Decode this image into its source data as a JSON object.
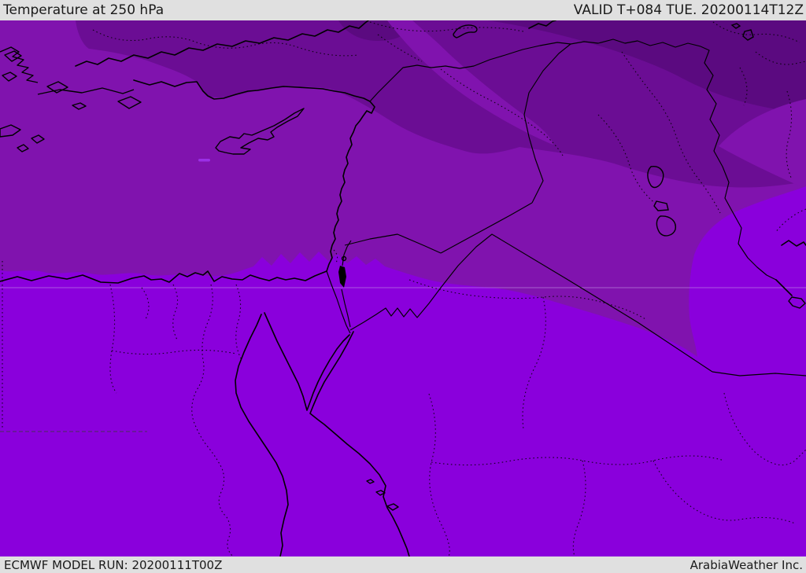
{
  "header": {
    "title": "Temperature at 250 hPa",
    "valid_label": "VALID T+084 TUE. 20200114T12Z"
  },
  "footer": {
    "model_run": "ECMWF MODEL RUN: 20200111T00Z",
    "brand": "ArabiaWeather Inc."
  },
  "map": {
    "colors": {
      "band_warm": "#8a00dc",
      "band_mid": "#8013ae",
      "band_cool": "#6b0d94",
      "band_coldest": "#5b0a80",
      "warm_speck": "#9b30e6",
      "gridline": "#c9a3e8",
      "line": "#000000",
      "bar_bg": "#e0e0e0",
      "bar_text": "#1a1a1a"
    }
  }
}
